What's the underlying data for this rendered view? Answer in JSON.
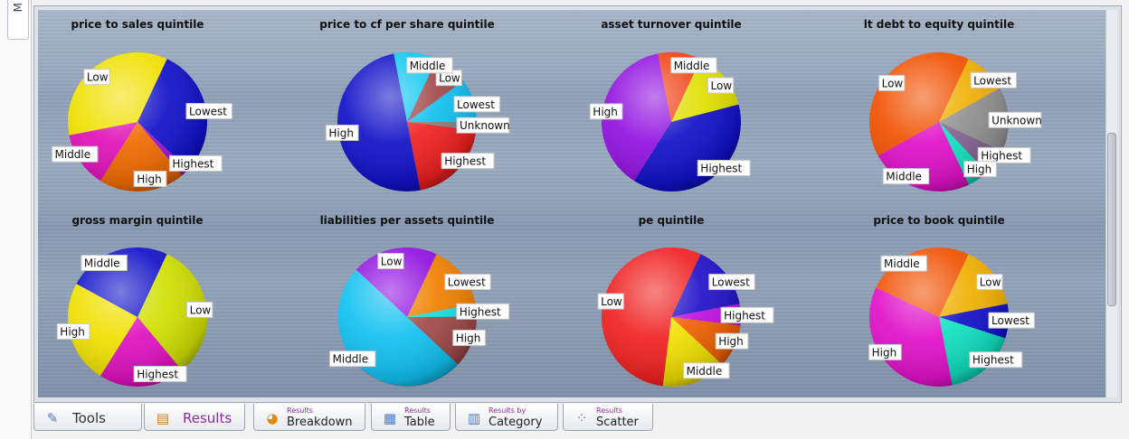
{
  "left_tab": {
    "label": "M"
  },
  "colors": {
    "background": "#8fa0b8",
    "label_bg": "#ffffff"
  },
  "tabs": [
    {
      "icon": "wrench-icon",
      "label": "Tools",
      "small": ""
    },
    {
      "icon": "results-icon",
      "label": "Results",
      "small": ""
    },
    {
      "icon": "pie-chart-icon",
      "label": "Breakdown",
      "small": "Results"
    },
    {
      "icon": "table-icon",
      "label": "Table",
      "small": "Results"
    },
    {
      "icon": "bar-chart-icon",
      "label": "Category",
      "small": "Results by"
    },
    {
      "icon": "scatter-icon",
      "label": "Scatter",
      "small": "Results"
    }
  ],
  "chart_data": [
    {
      "type": "pie",
      "title": "price to sales quintile",
      "slices": [
        {
          "label": "Lowest",
          "value": 30,
          "color": "#1010c8"
        },
        {
          "label": "Highest",
          "value": 2,
          "color": "#9a10d8"
        },
        {
          "label": "High",
          "value": 20,
          "color": "#f06a00"
        },
        {
          "label": "Middle",
          "value": 13,
          "color": "#e010b8"
        },
        {
          "label": "Low",
          "value": 35,
          "color": "#f0e000"
        }
      ]
    },
    {
      "type": "pie",
      "title": "price to cf per share quintile",
      "slices": [
        {
          "label": "Low",
          "value": 8,
          "color": "#a04848"
        },
        {
          "label": "Lowest",
          "value": 10,
          "color": "#10c0f0"
        },
        {
          "label": "Unknown",
          "value": 2,
          "color": "#808080"
        },
        {
          "label": "Highest",
          "value": 20,
          "color": "#f02020"
        },
        {
          "label": "High",
          "value": 50,
          "color": "#1010c8"
        },
        {
          "label": "Middle",
          "value": 10,
          "color": "#10c8f0"
        }
      ]
    },
    {
      "type": "pie",
      "title": "asset turnover quintile",
      "slices": [
        {
          "label": "Low",
          "value": 14,
          "color": "#e0e000"
        },
        {
          "label": "Highest",
          "value": 38,
          "color": "#1010c8"
        },
        {
          "label": "High",
          "value": 38,
          "color": "#9010e0"
        },
        {
          "label": "Middle",
          "value": 10,
          "color": "#f04010"
        }
      ]
    },
    {
      "type": "pie",
      "title": "lt debt to equity quintile",
      "slices": [
        {
          "label": "Lowest",
          "value": 10,
          "color": "#f0b000"
        },
        {
          "label": "Unknown",
          "value": 15,
          "color": "#909090"
        },
        {
          "label": "Highest",
          "value": 6,
          "color": "#806090"
        },
        {
          "label": "High",
          "value": 5,
          "color": "#10e0c0"
        },
        {
          "label": "Middle",
          "value": 24,
          "color": "#e010c8"
        },
        {
          "label": "Low",
          "value": 40,
          "color": "#f05000"
        }
      ]
    },
    {
      "type": "pie",
      "title": "gross margin quintile",
      "slices": [
        {
          "label": "Low",
          "value": 32,
          "color": "#d0e000"
        },
        {
          "label": "Highest",
          "value": 20,
          "color": "#e010c0"
        },
        {
          "label": "High",
          "value": 24,
          "color": "#f0e000"
        },
        {
          "label": "Middle",
          "value": 24,
          "color": "#1010c8"
        }
      ]
    },
    {
      "type": "pie",
      "title": "liabilities per assets quintile",
      "slices": [
        {
          "label": "Lowest",
          "value": 15,
          "color": "#f08000"
        },
        {
          "label": "Highest",
          "value": 3,
          "color": "#10e0e0"
        },
        {
          "label": "High",
          "value": 12,
          "color": "#a04848"
        },
        {
          "label": "Middle",
          "value": 50,
          "color": "#10c0f0"
        },
        {
          "label": "Low",
          "value": 20,
          "color": "#9010e0"
        }
      ]
    },
    {
      "type": "pie",
      "title": "pe quintile",
      "slices": [
        {
          "label": "Lowest",
          "value": 15,
          "color": "#2010c8"
        },
        {
          "label": "Highest",
          "value": 5,
          "color": "#c010e0"
        },
        {
          "label": "High",
          "value": 10,
          "color": "#f06000"
        },
        {
          "label": "Middle",
          "value": 15,
          "color": "#f0e000"
        },
        {
          "label": "Low",
          "value": 55,
          "color": "#f02020"
        }
      ]
    },
    {
      "type": "pie",
      "title": "price to book quintile",
      "slices": [
        {
          "label": "Low",
          "value": 15,
          "color": "#f0b000"
        },
        {
          "label": "Lowest",
          "value": 8,
          "color": "#1010c8"
        },
        {
          "label": "Highest",
          "value": 17,
          "color": "#10e0c0"
        },
        {
          "label": "High",
          "value": 35,
          "color": "#e010c8"
        },
        {
          "label": "Middle",
          "value": 25,
          "color": "#f05000"
        }
      ]
    }
  ]
}
